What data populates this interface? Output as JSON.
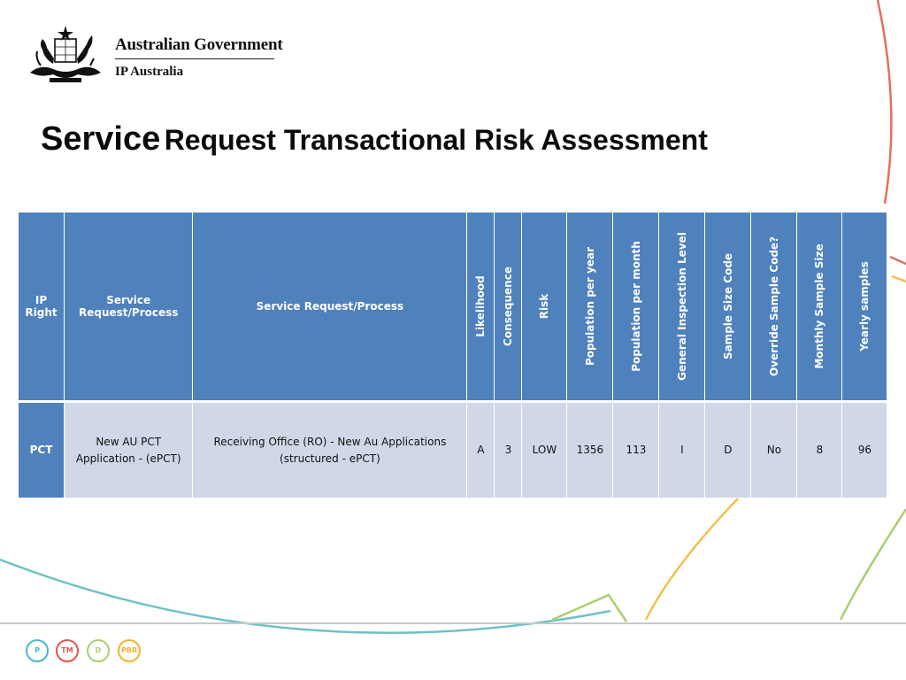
{
  "header": {
    "gov_name": "Australian Government",
    "agency": "IP Australia",
    "crest": "australian-coat-of-arms"
  },
  "title": {
    "first_word": "Service",
    "rest": "Request Transactional Risk Assessment"
  },
  "table": {
    "headers": [
      "IP Right",
      "Service Request/Process",
      "Service Request/Process",
      "Likelihood",
      "Consequence",
      "Risk",
      "Population per year",
      "Population per month",
      "General Inspection Level",
      "Sample Size Code",
      "Override Sample Code?",
      "Monthly Sample Size",
      "Yearly samples"
    ],
    "rows": [
      {
        "ip_right": "PCT",
        "service": "New AU PCT Application - (ePCT)",
        "process": "Receiving Office (RO) - New Au Applications (structured  - ePCT)",
        "likelihood": "A",
        "consequence": "3",
        "risk": "LOW",
        "pop_year": "1356",
        "pop_month": "113",
        "inspection_level": "I",
        "sample_code": "D",
        "override": "No",
        "monthly": "8",
        "yearly": "96"
      }
    ]
  },
  "footer": {
    "badges": [
      {
        "label": "P",
        "color": "#4bb9c9"
      },
      {
        "label": "TM",
        "color": "#e2574c"
      },
      {
        "label": "D",
        "color": "#a9cf6e"
      },
      {
        "label": "PBR",
        "color": "#f2b233"
      }
    ]
  },
  "colors": {
    "header_fill": "#4f81bd",
    "row_fill": "#d0d8e8",
    "arc_red": "#e07060",
    "arc_teal": "#6fc1c4",
    "arc_yellow": "#f2c14e",
    "arc_green": "#a9cf6e"
  }
}
